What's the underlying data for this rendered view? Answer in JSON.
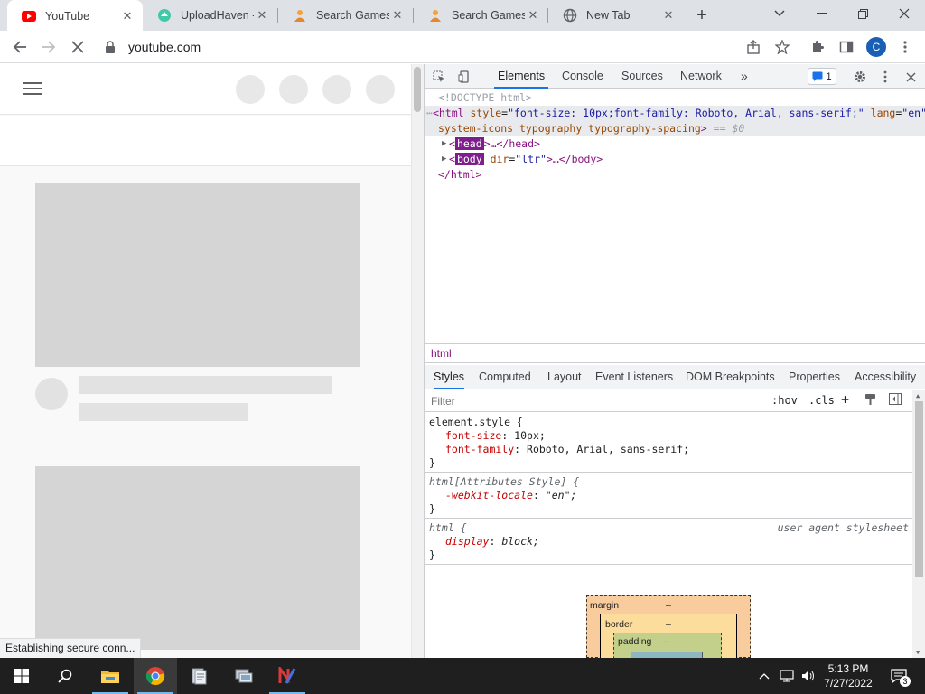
{
  "tabs": [
    {
      "title": "YouTube",
      "favicon": "youtube-icon",
      "active": true
    },
    {
      "title": "UploadHaven -",
      "favicon": "uploadhaven-icon",
      "active": false
    },
    {
      "title": "Search Games C",
      "favicon": "games-icon",
      "active": false
    },
    {
      "title": "Search Games C",
      "favicon": "games-icon",
      "active": false
    },
    {
      "title": "New Tab",
      "favicon": "globe-icon",
      "active": false
    }
  ],
  "window_controls": {
    "minimize": "—",
    "restore": "❐",
    "close": "✕",
    "tab_search": "⌄"
  },
  "toolbar": {
    "url": "youtube.com",
    "profile_initial": "C"
  },
  "page": {
    "status_text": "Establishing secure conn..."
  },
  "devtools": {
    "tabs": [
      "Elements",
      "Console",
      "Sources",
      "Network"
    ],
    "more": "»",
    "issues_count": "1",
    "dom": {
      "doctype": "<!DOCTYPE html>",
      "html_open_tag": "<html",
      "html_style_attr": "style",
      "html_style_val": "\"font-size: 10px;font-family: Roboto, Arial, sans-serif;\"",
      "html_lang_attr": "lang",
      "html_lang_val": "\"en\"",
      "html_line2": "system-icons typography typography-spacing",
      "html_line2_end": ">",
      "eq_sel": "== $0",
      "head_tag": "head",
      "head_rest": ">…</head>",
      "body_tag": "body",
      "body_attr": "dir",
      "body_val": "\"ltr\"",
      "body_rest": ">…</body>",
      "html_close": "</html>"
    },
    "breadcrumb": "html",
    "subtabs": [
      "Styles",
      "Computed",
      "Layout",
      "Event Listeners",
      "DOM Breakpoints",
      "Properties",
      "Accessibility"
    ],
    "filter_placeholder": "Filter",
    "hov": ":hov",
    "cls": ".cls",
    "rules": [
      {
        "selector": "element.style {",
        "props": [
          {
            "name": "font-size",
            "value": "10px;"
          },
          {
            "name": "font-family",
            "value": "Roboto, Arial, sans-serif;"
          }
        ],
        "close": "}"
      },
      {
        "selector": "html[Attributes Style] {",
        "props": [
          {
            "name": "-webkit-locale",
            "value": "\"en\";"
          }
        ],
        "close": "}"
      },
      {
        "selector": "html {",
        "source": "user agent stylesheet",
        "props": [
          {
            "name": "display",
            "value": "block;"
          }
        ],
        "close": "}"
      }
    ],
    "boxmodel": {
      "margin": "margin",
      "border": "border",
      "padding": "padding",
      "dash": "–"
    }
  },
  "taskbar": {
    "time": "5:13 PM",
    "date": "7/27/2022",
    "notifications": "3"
  },
  "colors": {
    "tabstrip_bg": "#dee1e6",
    "accent": "#1a73e8",
    "profile": "#1a5fb4",
    "taskbar_bg": "#1f1f1f"
  }
}
